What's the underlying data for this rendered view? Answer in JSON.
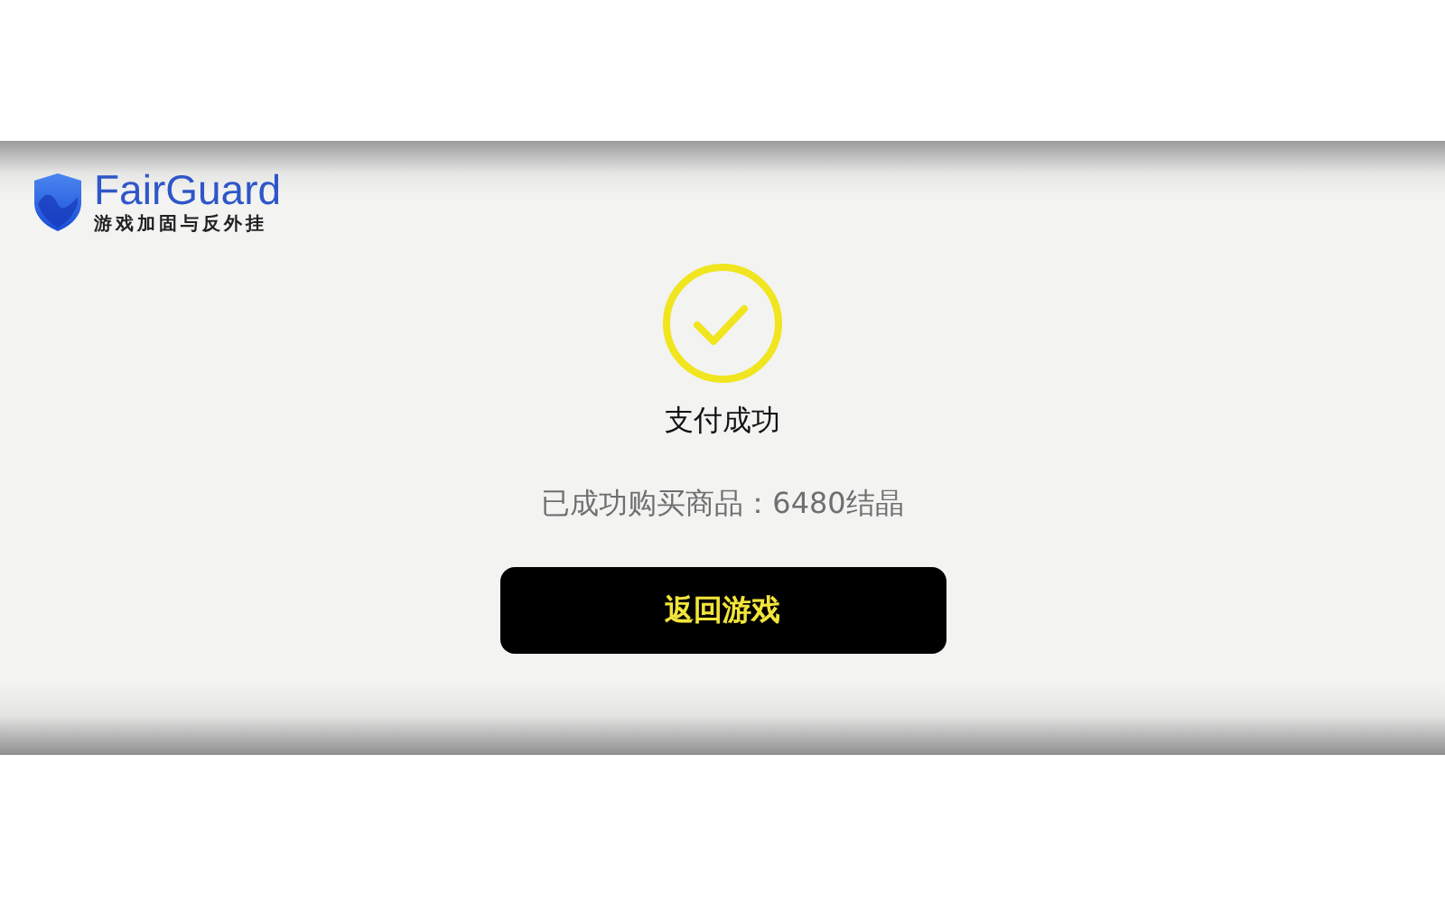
{
  "logo": {
    "name": "FairGuard",
    "tagline": "游戏加固与反外挂"
  },
  "result": {
    "title": "支付成功",
    "message": "已成功购买商品：6480结晶"
  },
  "button": {
    "label": "返回游戏"
  }
}
